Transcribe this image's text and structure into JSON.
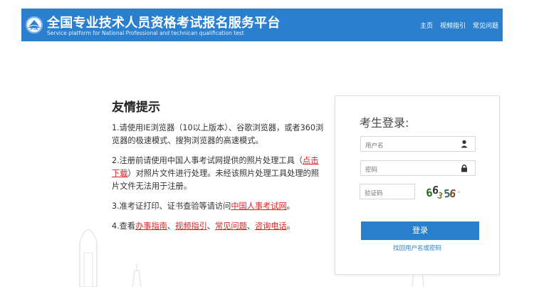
{
  "header": {
    "title_cn": "全国专业技术人员资格考试报名服务平台",
    "title_en": "Service platform for National Professional and technican qualification test",
    "logo_text": "PTA",
    "nav": [
      "主页",
      "视频指引",
      "常见问题"
    ],
    "background": "#2b7fcf"
  },
  "tips": {
    "title": "友情提示",
    "items": [
      {
        "before": "1.请使用IE浏览器（10以上版本）、谷歌浏览器，或者360浏览器的极速模式、搜狗浏览器的高速模式。"
      },
      {
        "before": "2.注册前请使用中国人事考试网提供的照片处理工具（",
        "link": "点击下载",
        "after": "）对照片文件进行处理。未经该照片处理工具处理的照片文件无法用于注册。"
      },
      {
        "before": "3.准考证打印、证书查验等请访问",
        "link": "中国人事考试网",
        "after": "。"
      },
      {
        "before": "4.查看",
        "links": [
          "办事指南",
          "视频指引",
          "常见问题",
          "咨询电话"
        ],
        "sep": "、",
        "after": "。"
      }
    ],
    "link_color": "#e02020"
  },
  "login": {
    "title": "考生登录:",
    "username_placeholder": "用户名",
    "username_icon": "user-icon",
    "password_placeholder": "密码",
    "password_icon": "lock-icon",
    "captcha_placeholder": "验证码",
    "captcha_text": "66356",
    "submit_label": "登录",
    "forgot_label": "找回用户名或密码",
    "accent": "#2a7fcb"
  }
}
